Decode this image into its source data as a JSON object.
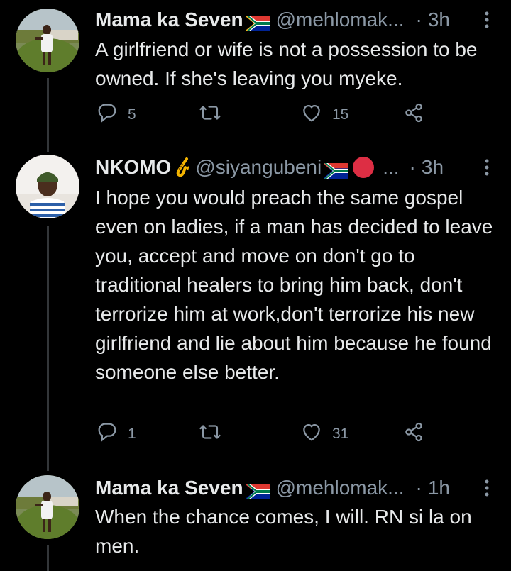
{
  "tweets": [
    {
      "name": "Mama ka Seven",
      "handle": "@mehlomak...",
      "dot": "·",
      "time": "3h",
      "text": "A girlfriend or wife is not a possession to be owned. If she's leaving you myeke.",
      "replies": "5",
      "retweets": "",
      "likes": "15"
    },
    {
      "name": "NKOMO",
      "handle": "@siyangubeni",
      "ellipsis": "...",
      "dot": "·",
      "time": "3h",
      "text": "I hope you would preach the same gospel even on ladies, if a man has decided to leave you, accept and move on don't go to traditional healers to bring him back, don't terrorize him at work,don't terrorize his new girlfriend and lie about him because he found someone else better.",
      "replies": "1",
      "retweets": "",
      "likes": "31"
    },
    {
      "name": "Mama ka Seven",
      "handle": "@mehlomak...",
      "dot": "·",
      "time": "1h",
      "text": "When the chance comes, I will. RN si la on men."
    }
  ],
  "icons": {
    "reply": "reply-icon",
    "retweet": "retweet-icon",
    "like": "heart-icon",
    "share": "share-icon",
    "more": "more-vertical-icon",
    "flag": "south-africa-flag-icon",
    "sax": "saxophone-icon",
    "red_circle": "red-circle-icon"
  },
  "colors": {
    "background": "#000000",
    "text": "#e7e9ea",
    "muted": "#8b98a5",
    "thread_line": "#333639"
  }
}
